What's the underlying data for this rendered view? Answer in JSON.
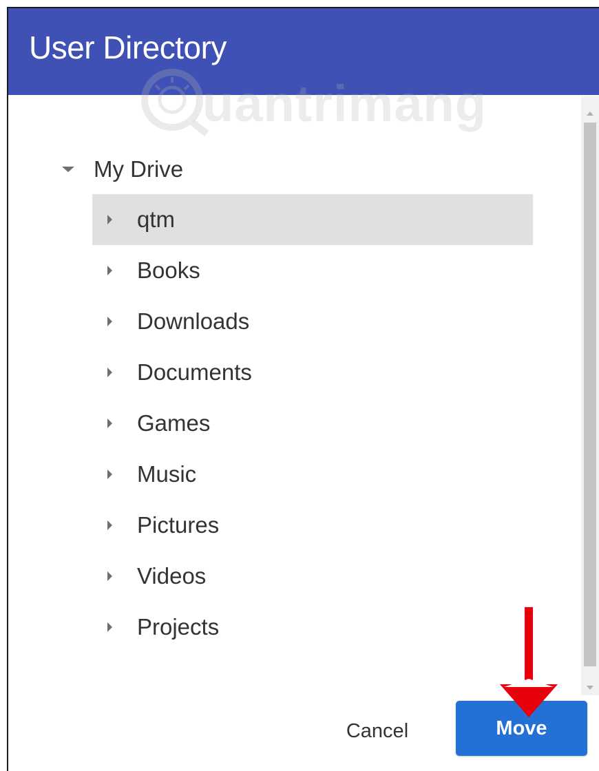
{
  "dialog": {
    "title": "User Directory"
  },
  "watermark": {
    "text": "uantrimang"
  },
  "tree": {
    "root_label": "My Drive",
    "items": [
      {
        "label": "qtm",
        "selected": true
      },
      {
        "label": "Books"
      },
      {
        "label": "Downloads"
      },
      {
        "label": "Documents"
      },
      {
        "label": "Games"
      },
      {
        "label": "Music"
      },
      {
        "label": "Pictures"
      },
      {
        "label": "Videos"
      },
      {
        "label": "Projects"
      }
    ]
  },
  "actions": {
    "cancel_label": "Cancel",
    "move_label": "Move"
  },
  "colors": {
    "header": "#3f51b5",
    "primary_button": "#2470d4",
    "selected_row": "#e0e0e0",
    "annotation_arrow": "#e8000b"
  },
  "icons": {
    "expand": "caret-down-icon",
    "collapsed": "caret-right-icon",
    "annotation": "down-arrow-icon"
  }
}
